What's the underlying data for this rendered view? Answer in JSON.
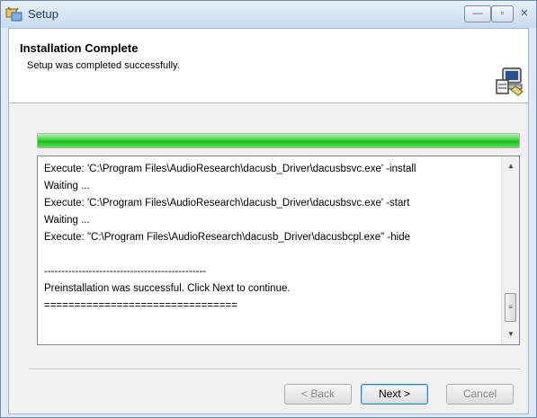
{
  "window": {
    "title": "Setup",
    "controls": {
      "minimize": "—",
      "maximize": "▫",
      "close": "✕"
    }
  },
  "header": {
    "title": "Installation Complete",
    "subtitle": "Setup was completed successfully."
  },
  "progress": {
    "value_percent": 100,
    "color": "#2fc52f"
  },
  "log": {
    "lines": [
      "Execute: 'C:\\Program Files\\AudioResearch\\dacusb_Driver\\dacusbsvc.exe' -install",
      "Waiting ...",
      "Execute: 'C:\\Program Files\\AudioResearch\\dacusb_Driver\\dacusbsvc.exe' -start",
      "Waiting ...",
      "Execute: \"C:\\Program Files\\AudioResearch\\dacusb_Driver\\dacusbcpl.exe\" -hide",
      "",
      "-----------------------------------------------",
      "Preinstallation was successful. Click Next to continue.",
      "================================"
    ],
    "scroll_up_icon": "▲",
    "scroll_down_icon": "▼",
    "scroll_thumb_grip": "≡"
  },
  "buttons": {
    "back": "< Back",
    "next": "Next >",
    "cancel": "Cancel"
  },
  "colors": {
    "accent": "#3c7fb1",
    "title_text": "#1e395b"
  }
}
